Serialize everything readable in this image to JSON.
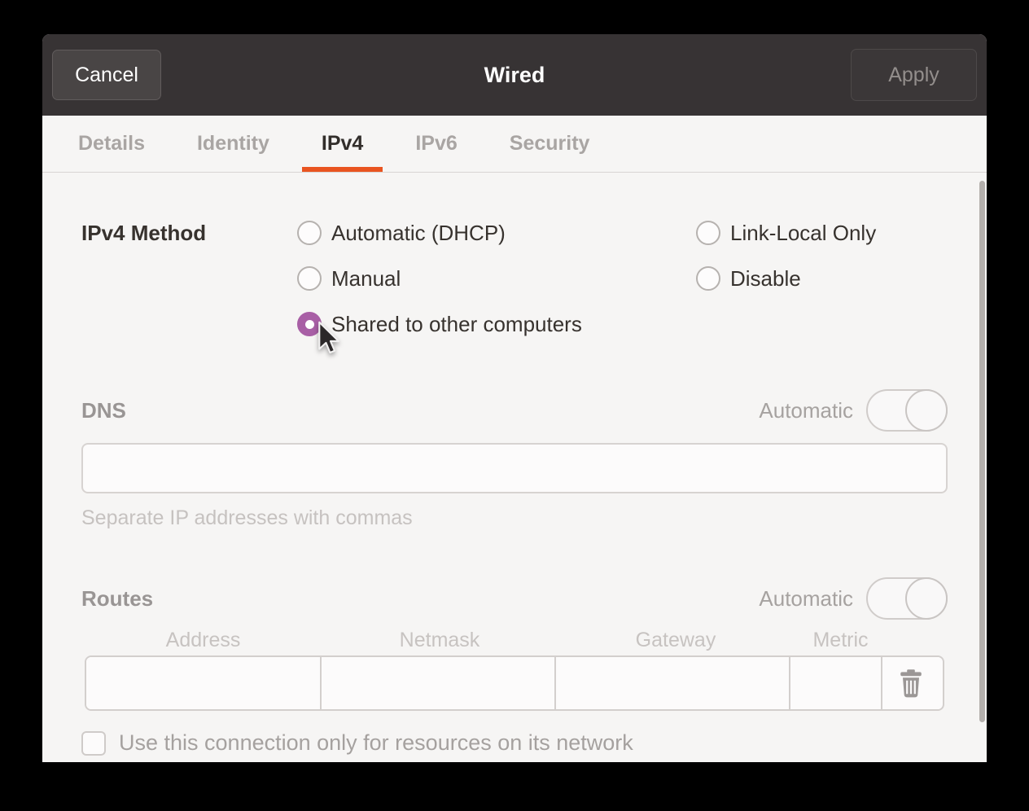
{
  "header": {
    "cancel": "Cancel",
    "title": "Wired",
    "apply": "Apply"
  },
  "tabs": [
    {
      "label": "Details"
    },
    {
      "label": "Identity"
    },
    {
      "label": "IPv4"
    },
    {
      "label": "IPv6"
    },
    {
      "label": "Security"
    }
  ],
  "active_tab": "IPv4",
  "method": {
    "label": "IPv4 Method",
    "col1": [
      {
        "label": "Automatic (DHCP)",
        "selected": false
      },
      {
        "label": "Manual",
        "selected": false
      },
      {
        "label": "Shared to other computers",
        "selected": true
      }
    ],
    "col2": [
      {
        "label": "Link-Local Only",
        "selected": false
      },
      {
        "label": "Disable",
        "selected": false
      }
    ]
  },
  "dns": {
    "label": "DNS",
    "toggle_label": "Automatic",
    "toggle_state": "on",
    "enabled": false,
    "value": "",
    "helper": "Separate IP addresses with commas"
  },
  "routes": {
    "label": "Routes",
    "toggle_label": "Automatic",
    "toggle_state": "on",
    "enabled": false,
    "columns": [
      "Address",
      "Netmask",
      "Gateway",
      "Metric"
    ],
    "row": {
      "address": "",
      "netmask": "",
      "gateway": "",
      "metric": ""
    },
    "delete_icon": "trash-icon"
  },
  "options": {
    "checkbox_label": "Use this connection only for resources on its network",
    "checked": false
  },
  "colors": {
    "accent_orange": "#E95420",
    "radio_selected_purple": "#A85FA5",
    "header_bg": "#373334",
    "content_bg": "#f6f5f4"
  }
}
